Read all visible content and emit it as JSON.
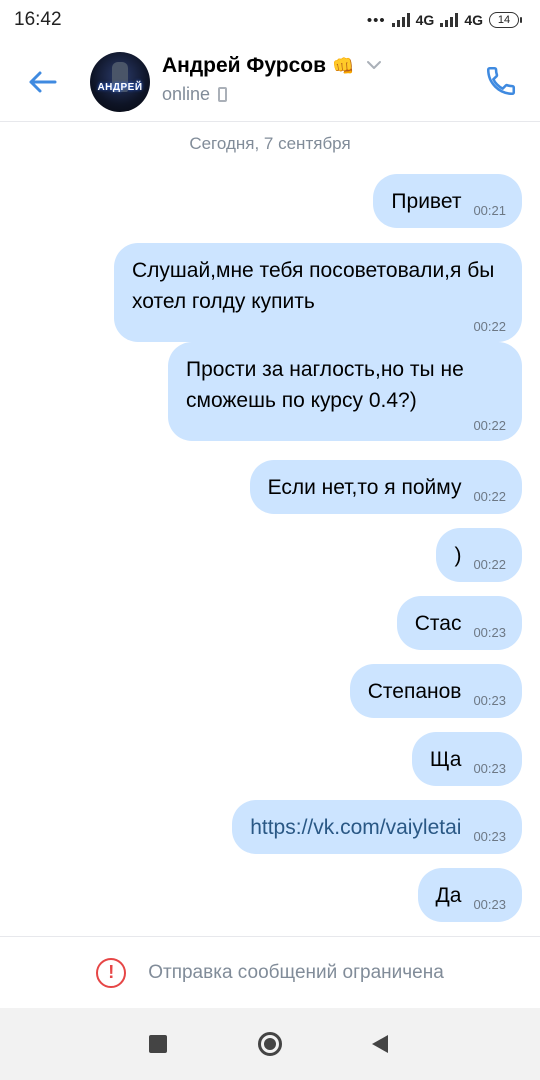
{
  "status_bar": {
    "time": "16:42",
    "dots": "•••",
    "network_1": "4G",
    "network_2": "4G",
    "battery": "14"
  },
  "header": {
    "avatar_text": "АНДРЕЙ",
    "contact_name": "Андрей Фурсов",
    "contact_emoji": "👊",
    "status": "online",
    "icons": [
      "back-arrow-icon",
      "chevron-down-icon",
      "mobile-phone-icon",
      "call-icon"
    ]
  },
  "chat": {
    "date_separator": "Сегодня, 7 сентября",
    "messages": [
      {
        "text": "Привет",
        "time": "00:21"
      },
      {
        "text": "Слушай,мне тебя посоветовали,я бы хотел голду купить",
        "time": "00:22"
      },
      {
        "text": "Прости за наглость,но ты не сможешь по курсу 0.4?)",
        "time": "00:22"
      },
      {
        "text": "Если нет,то я пойму",
        "time": "00:22"
      },
      {
        "text": ")",
        "time": "00:22"
      },
      {
        "text": "Стас",
        "time": "00:23"
      },
      {
        "text": "Степанов",
        "time": "00:23"
      },
      {
        "text": "Ща",
        "time": "00:23"
      },
      {
        "text": "https://vk.com/vaiyletai",
        "time": "00:23"
      },
      {
        "text": "Да",
        "time": "00:23"
      }
    ]
  },
  "composer": {
    "restricted_text": "Отправка сообщений ограничена",
    "icon": "warning-icon"
  },
  "navigation": {
    "icons": [
      "recent-apps-icon",
      "home-icon",
      "back-icon"
    ]
  },
  "colors": {
    "accent": "#3f8ae0",
    "bubble_outgoing": "#cce4ff",
    "link": "#2a5885",
    "muted": "#818c99",
    "warning": "#e64646"
  }
}
